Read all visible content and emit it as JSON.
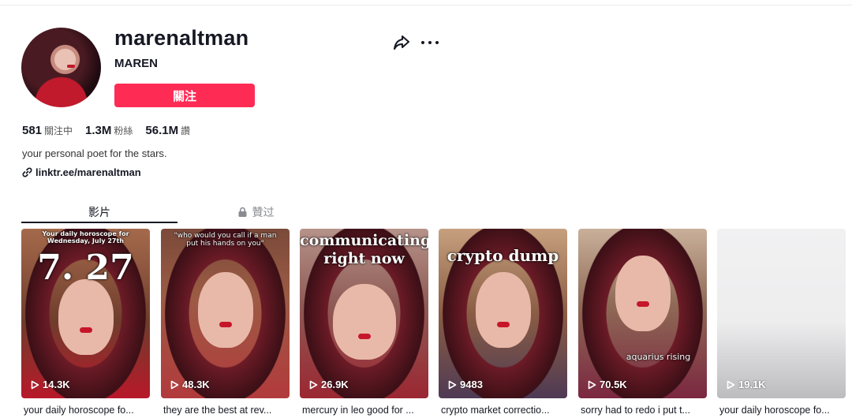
{
  "profile": {
    "username": "marenaltman",
    "nickname": "MAREN",
    "follow_label": "關注",
    "bio": "your personal poet for the stars.",
    "link": "linktr.ee/marenaltman"
  },
  "stats": [
    {
      "value": "581",
      "label": "關注中"
    },
    {
      "value": "1.3M",
      "label": "粉絲"
    },
    {
      "value": "56.1M",
      "label": "讚"
    }
  ],
  "tabs": {
    "videos": "影片",
    "liked": "贊过"
  },
  "videos": [
    {
      "plays": "14.3K",
      "desc": "your daily horoscope fo...",
      "cap_small": "Your daily horoscope for Wednesday, July 27th",
      "cap_big": "7. 27"
    },
    {
      "plays": "48.3K",
      "desc": "they are the best at rev...",
      "cap_small": "\"who would you call if a man put his hands on you\""
    },
    {
      "plays": "26.9K",
      "desc": "mercury in leo good for ...",
      "cap_big": "communicating right now"
    },
    {
      "plays": "9483",
      "desc": "crypto market correctio...",
      "cap_big": "crypto dump"
    },
    {
      "plays": "70.5K",
      "desc": "sorry had to redo i put t...",
      "cap_small": "aquarius rising"
    },
    {
      "plays": "19.1K",
      "desc": "your daily horoscope fo..."
    }
  ],
  "colors": {
    "accent": "#fe2c55",
    "text": "#161823",
    "muted": "#8a8b91"
  },
  "icons": [
    "share-icon",
    "more-icon",
    "link-icon",
    "lock-icon",
    "play-icon"
  ]
}
